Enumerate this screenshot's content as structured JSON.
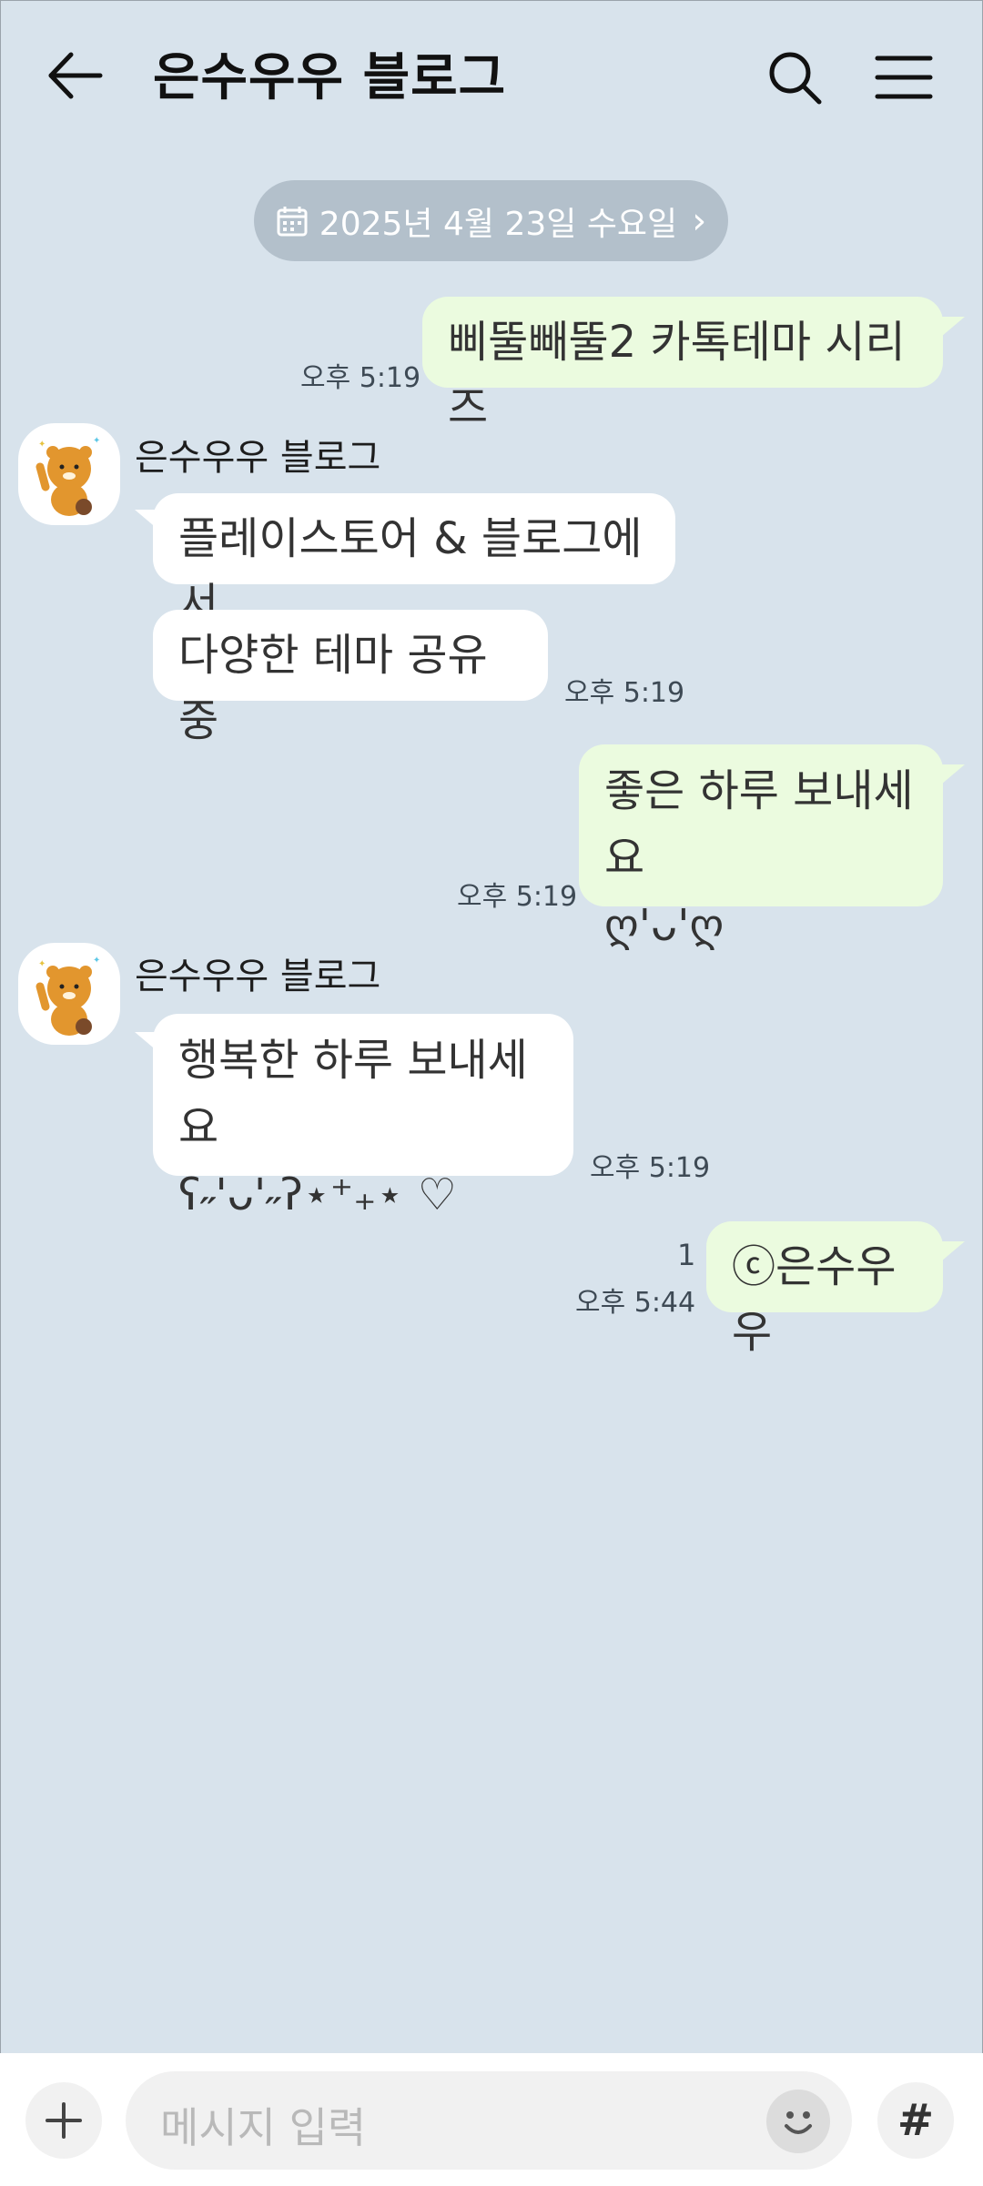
{
  "header": {
    "title": "은수우우 블로그",
    "back_icon": "arrow-left-icon",
    "search_icon": "search-icon",
    "menu_icon": "hamburger-menu-icon"
  },
  "date_pill": {
    "label": "2025년 4월 23일 수요일",
    "icon": "calendar-icon",
    "chevron": "›"
  },
  "messages": [
    {
      "from": "me",
      "text": "삐뚤빼뚤2 카톡테마 시리즈",
      "time": "오후 5:19"
    },
    {
      "from": "them",
      "sender": "은수우우 블로그",
      "text": "플레이스토어 & 블로그에서"
    },
    {
      "from": "them",
      "text": "다양한 테마 공유 중",
      "time": "오후 5:19"
    },
    {
      "from": "me",
      "text_line1": "좋은 하루 보내세요",
      "text_line2": "ღ'ᴗ'ღ",
      "time": "오후 5:19"
    },
    {
      "from": "them",
      "sender": "은수우우 블로그",
      "text_line1": "행복한 하루 보내세요",
      "text_line2": "ʕ˶'ᴗ'˶ʔ⋆⁺₊⋆ ♡",
      "time": "오후 5:19"
    },
    {
      "from": "me",
      "text": "ⓒ은수우우",
      "time": "오후 5:44",
      "unread": "1"
    }
  ],
  "composer": {
    "placeholder": "메시지 입력",
    "plus": "+",
    "hash": "#",
    "emoji_icon": "smiley-icon"
  },
  "colors": {
    "background": "#d8e3ec",
    "my_bubble": "#ebfbdf",
    "their_bubble": "#ffffff",
    "date_pill": "#b3c0cb"
  }
}
